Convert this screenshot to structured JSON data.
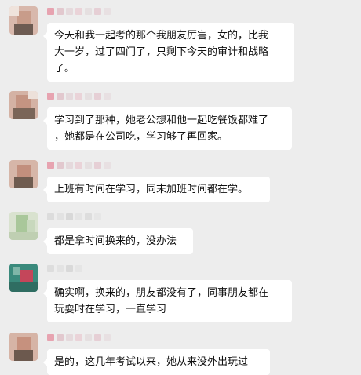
{
  "chat": {
    "messages": [
      {
        "text": "今天和我一起考的那个我朋友厉害，女的，比我\n大一岁，过了四门了，只剩下今天的审计和战略\n了。"
      },
      {
        "text": "学习到了那种，她老公想和他一起吃餐饭都难了\n，她都是在公司吃，学习够了再回家。"
      },
      {
        "text": "上班有时间在学习，同末加班时间都在学。"
      },
      {
        "text": "都是拿时间换来的，没办法"
      },
      {
        "text": "确实啊，换来的，朋友都没有了，同事朋友都在\n玩耍时在学习，一直学习"
      },
      {
        "text": "是的，这几年考试以来，她从来没外出玩过"
      }
    ]
  }
}
